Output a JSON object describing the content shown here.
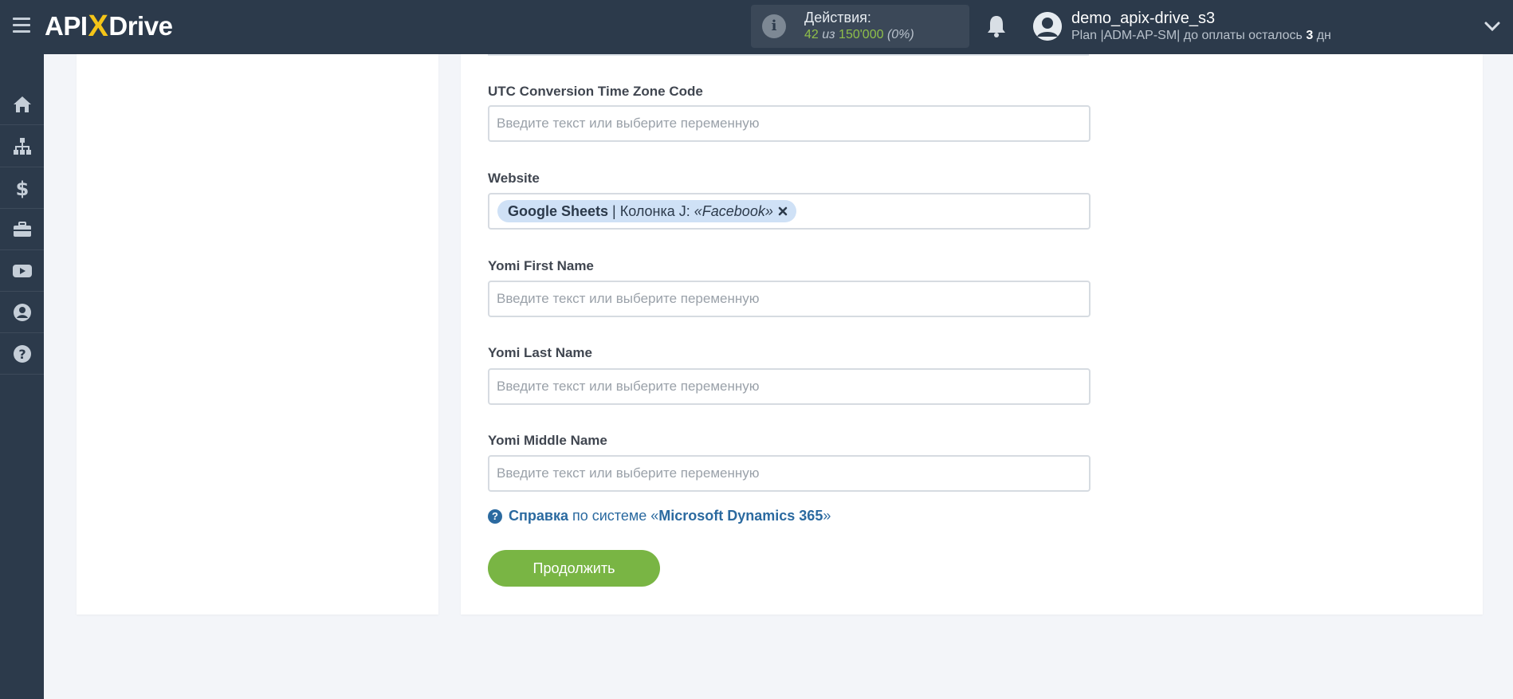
{
  "topbar": {
    "logo_api": "API",
    "logo_x": "X",
    "logo_drive": "Drive",
    "actions_title": "Действия:",
    "actions_used": "42",
    "actions_of": "из",
    "actions_total": "150'000",
    "actions_percent": "(0%)",
    "user_name": "demo_apix-drive_s3",
    "plan_text": "Plan |ADM-AP-SM| до оплаты осталось",
    "plan_days": "3",
    "plan_days_unit": "дн"
  },
  "sidebar": {
    "items": [
      {
        "name": "home",
        "icon": "home-icon"
      },
      {
        "name": "connections",
        "icon": "sitemap-icon"
      },
      {
        "name": "billing",
        "icon": "dollar-icon"
      },
      {
        "name": "tools",
        "icon": "briefcase-icon"
      },
      {
        "name": "video",
        "icon": "youtube-icon"
      },
      {
        "name": "account",
        "icon": "user-circle-icon"
      },
      {
        "name": "help",
        "icon": "question-circle-icon"
      }
    ]
  },
  "form": {
    "fields": [
      {
        "label": "UTC Conversion Time Zone Code",
        "placeholder": "Введите текст или выберите переменную"
      },
      {
        "label": "Website",
        "tag": {
          "source": "Google Sheets",
          "separator": "|",
          "column": "Колонка J:",
          "value": "«Facebook»"
        }
      },
      {
        "label": "Yomi First Name",
        "placeholder": "Введите текст или выберите переменную"
      },
      {
        "label": "Yomi Last Name",
        "placeholder": "Введите текст или выберите переменную"
      },
      {
        "label": "Yomi Middle Name",
        "placeholder": "Введите текст или выберите переменную"
      }
    ],
    "help": {
      "link": "Справка",
      "text_before": "по системе «",
      "system": "Microsoft Dynamics 365",
      "text_after": "»"
    },
    "continue_label": "Продолжить"
  },
  "colors": {
    "topbar_bg": "#2c3a4b",
    "accent_green": "#79b544",
    "link_blue": "#2b6aa0",
    "tag_bg": "#cfe1f6"
  }
}
